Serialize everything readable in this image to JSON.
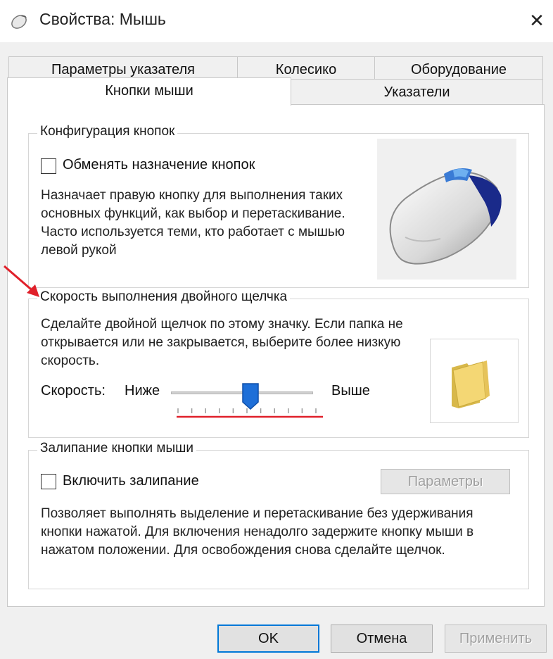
{
  "window": {
    "title": "Свойства: Мышь",
    "close": "✕",
    "icon": "mouse-icon"
  },
  "tabs": {
    "row1": [
      "Параметры указателя",
      "Колесико",
      "Оборудование"
    ],
    "row2": [
      "Кнопки мыши",
      "Указатели"
    ],
    "active": "Кнопки мыши"
  },
  "buttons_config": {
    "title": "Конфигурация кнопок",
    "swap_label": "Обменять назначение кнопок",
    "swap_checked": false,
    "description": "Назначает правую кнопку для выполнения таких основных функций, как выбор и перетаскивание. Часто используется теми, кто работает с мышью левой рукой"
  },
  "double_click": {
    "title": "Скорость выполнения двойного щелчка",
    "description": "Сделайте двойной щелчок по этому значку. Если папка не открывается или не закрывается, выберите более низкую скорость.",
    "speed_label": "Скорость:",
    "low_label": "Ниже",
    "high_label": "Выше",
    "speed_value_fraction": 0.56,
    "tick_count": 11
  },
  "click_lock": {
    "title": "Залипание кнопки мыши",
    "enable_label": "Включить залипание",
    "enable_checked": false,
    "settings_button": "Параметры",
    "description": "Позволяет выполнять выделение и перетаскивание без удерживания кнопки нажатой. Для включения ненадолго задержите кнопку мыши в нажатом положении. Для освобождения снова сделайте щелчок."
  },
  "footer": {
    "ok": "OK",
    "cancel": "Отмена",
    "apply": "Применить"
  },
  "colors": {
    "accent": "#0078d7",
    "annotation": "#e0202a",
    "thumb": "#1e6fd8"
  }
}
